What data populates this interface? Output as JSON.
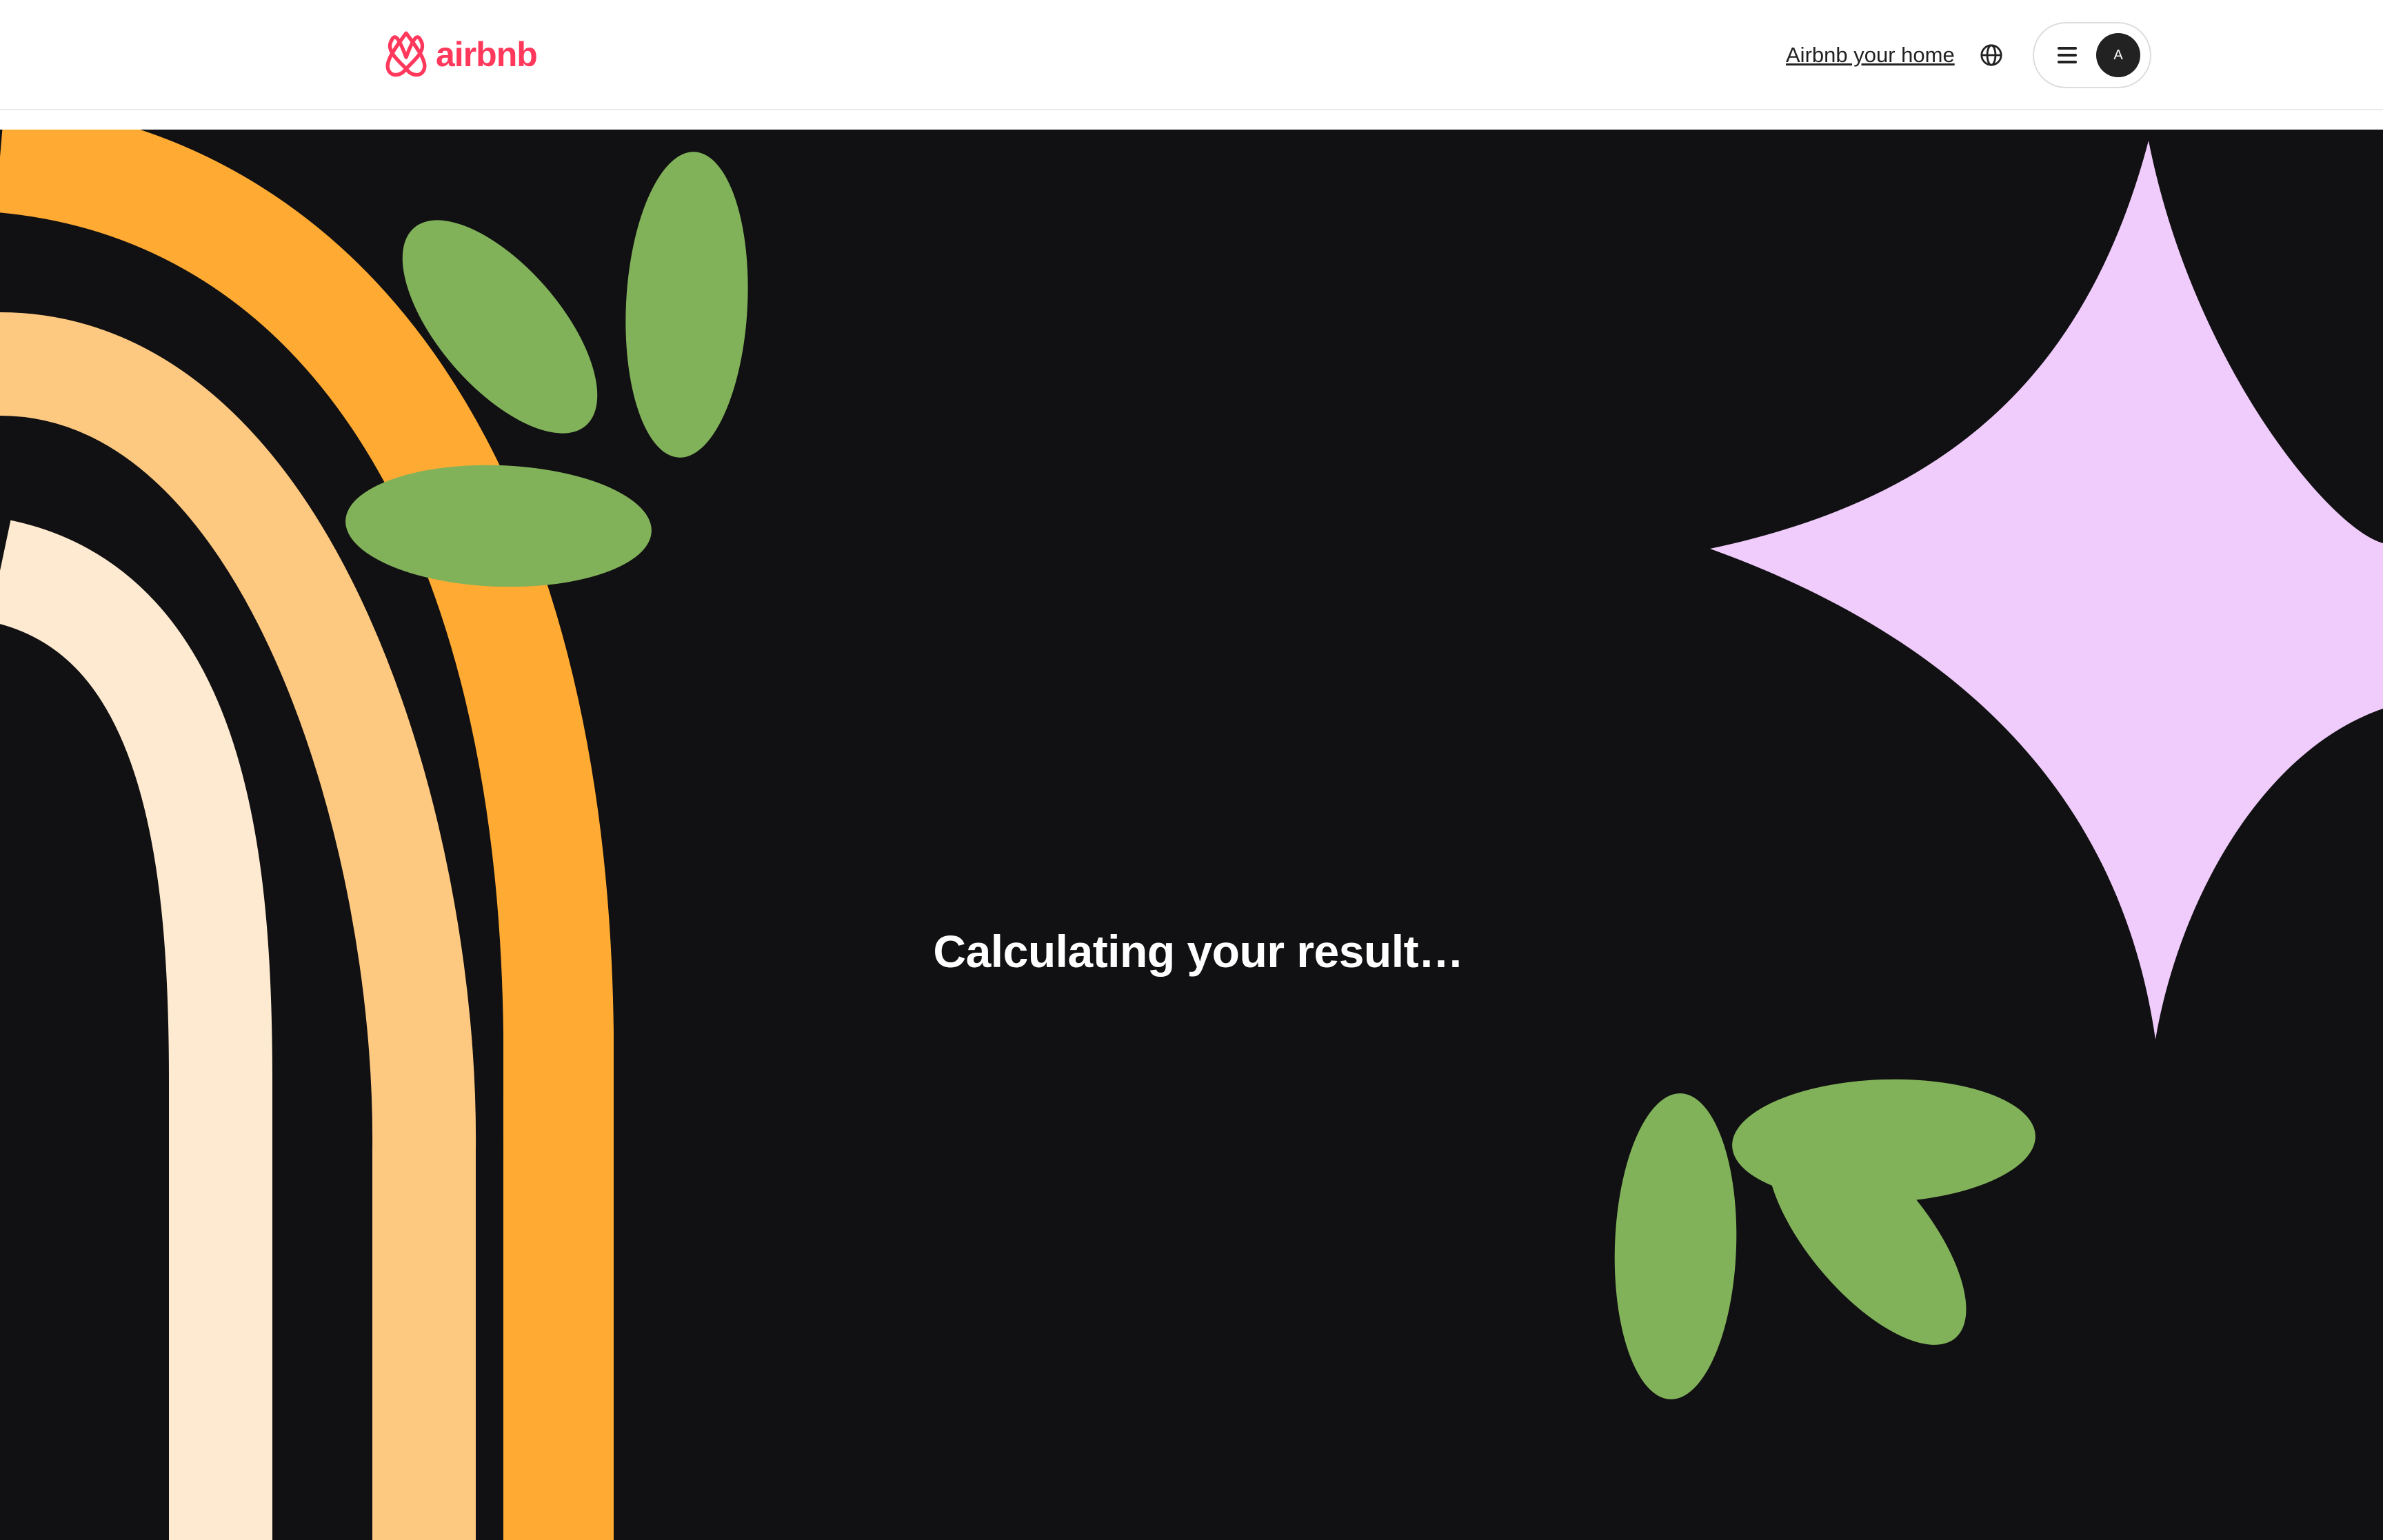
{
  "header": {
    "logo_text": "airbnb",
    "brand_color": "#FF385C",
    "host_link_label": "Airbnb your home",
    "language_icon": "globe-icon",
    "menu_icon": "hamburger-menu-icon",
    "avatar_initial": "A"
  },
  "main": {
    "status_text": "Calculating your result…",
    "background_color": "#111012",
    "decor_colors": {
      "arc_outer": "#FFAB33",
      "arc_middle": "#FDC981",
      "arc_inner": "#FDEAD0",
      "leaves": "#81B25A",
      "sparkle": "#EFCCFB"
    }
  }
}
